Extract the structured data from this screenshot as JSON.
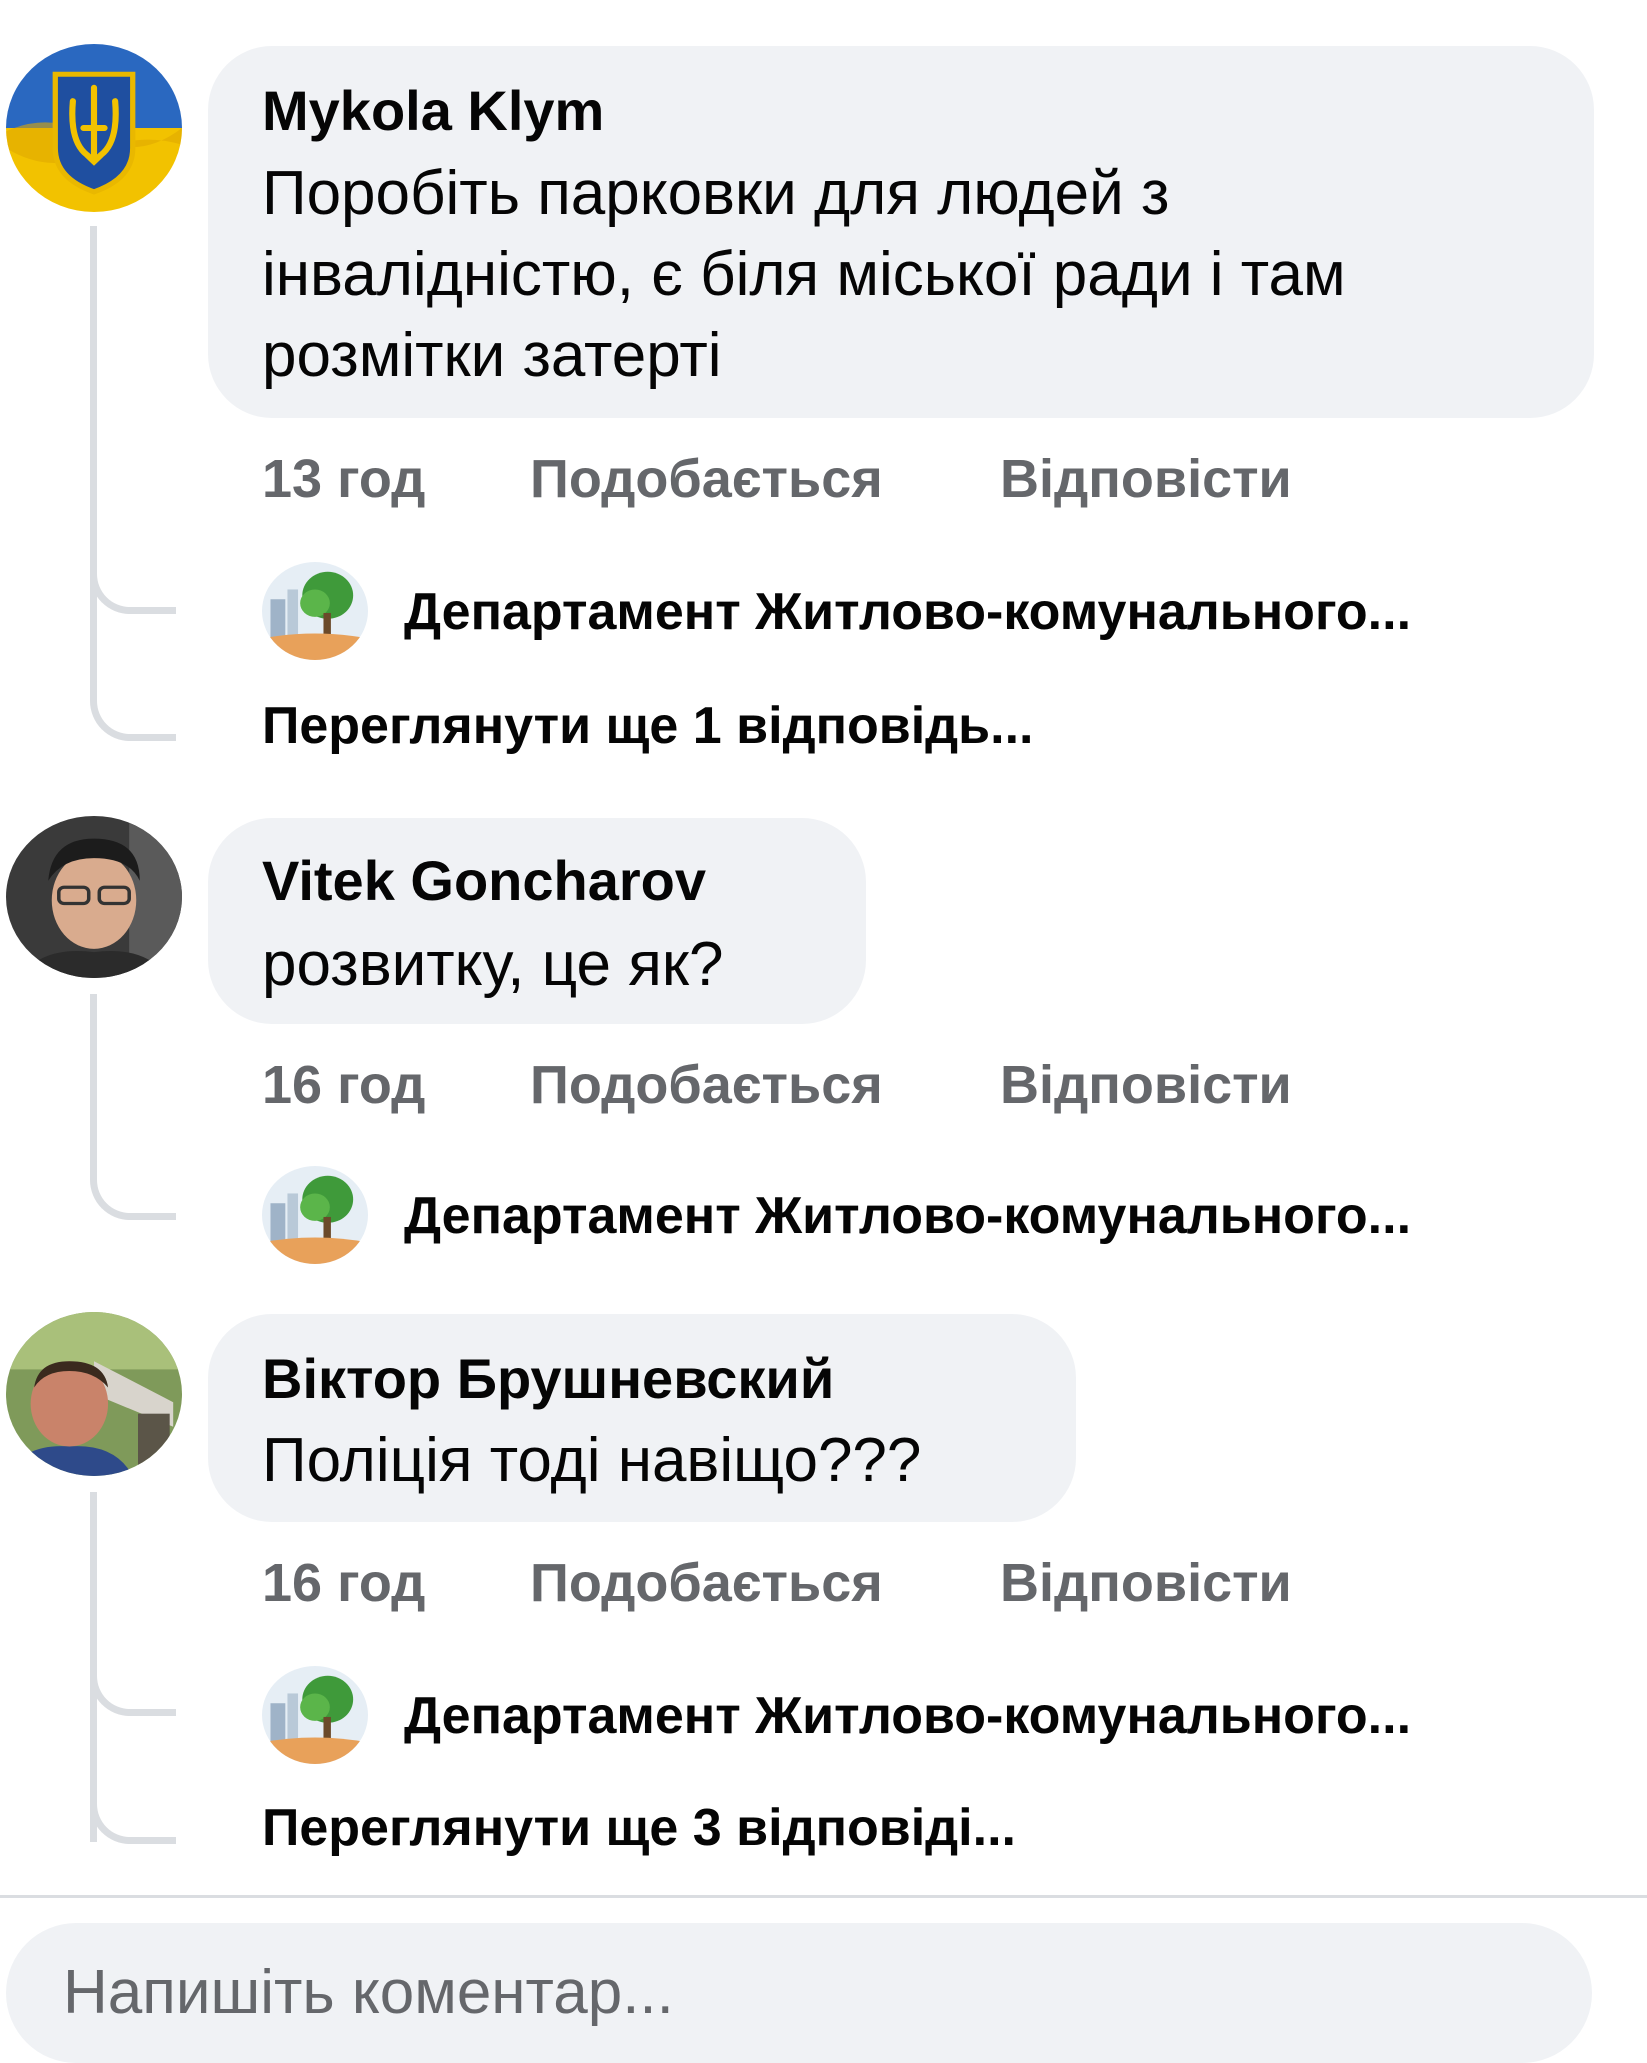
{
  "comments": [
    {
      "author": "Mykola Klym",
      "text_lines": [
        "Поробіть парковки для людей з",
        "інвалідністю, є біля міської ради і там",
        "розмітки затерті"
      ],
      "time": "13 год",
      "like": "Подобається",
      "reply": "Відповісти",
      "reply_preview": "Департамент Житлово-комунального...",
      "more_replies": "Переглянути ще 1 відповідь..."
    },
    {
      "author": "Vitek  Goncharov",
      "text_lines": [
        "розвитку, це як?"
      ],
      "time": "16 год",
      "like": "Подобається",
      "reply": "Відповісти",
      "reply_preview": "Департамент Житлово-комунального..."
    },
    {
      "author": "Віктор Брушневский",
      "text_lines": [
        "Поліція тоді навіщо???"
      ],
      "time": "16 год",
      "like": "Подобається",
      "reply": "Відповісти",
      "reply_preview": "Департамент Житлово-комунального...",
      "more_replies": "Переглянути ще 3 відповіді..."
    }
  ],
  "composer": {
    "placeholder": "Напишіть коментар..."
  },
  "colors": {
    "bubble": "#f0f2f5",
    "meta_text": "#65676b",
    "thread_line": "#dadde1",
    "ukraine_blue": "#1f5fb3",
    "ukraine_yellow": "#f5c400"
  },
  "icons": {
    "avatar_1": "ukraine-trident-avatar",
    "reply_avatar": "department-tree-avatar"
  }
}
